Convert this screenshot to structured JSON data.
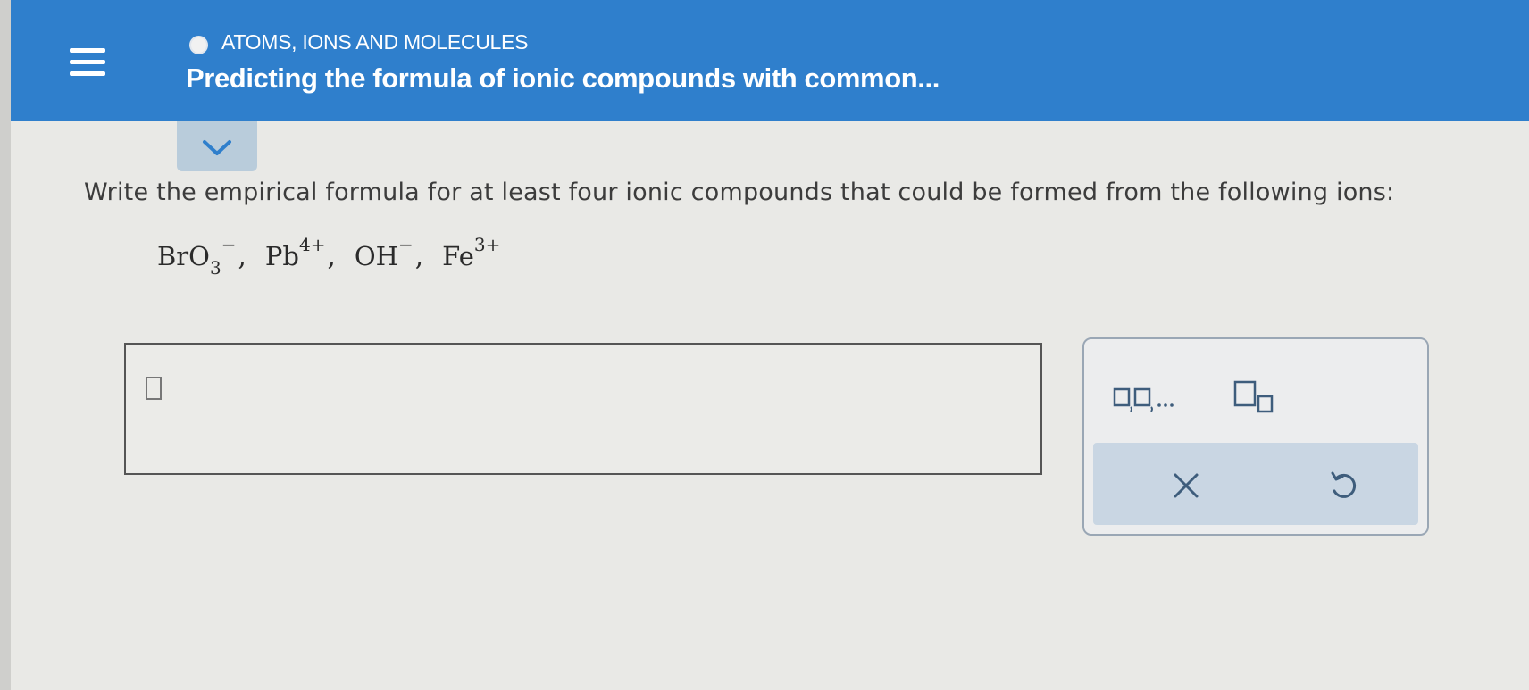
{
  "header": {
    "topic": "ATOMS, IONS AND MOLECULES",
    "title": "Predicting the formula of ionic compounds with common..."
  },
  "question": {
    "prompt": "Write the empirical formula for at least four ionic compounds that could be formed from the following ions:",
    "ions": [
      {
        "symbol": "BrO",
        "subscript": "3",
        "charge": "−",
        "separator": ","
      },
      {
        "symbol": "Pb",
        "subscript": "",
        "charge": "4+",
        "separator": ","
      },
      {
        "symbol": "OH",
        "subscript": "",
        "charge": "−",
        "separator": ","
      },
      {
        "symbol": "Fe",
        "subscript": "",
        "charge": "3+",
        "separator": ""
      }
    ]
  },
  "toolbar": {
    "sequence_label": "□,□,...",
    "icons": [
      "menu-icon",
      "chevron-down-icon",
      "sequence-icon",
      "subscript-icon",
      "clear-icon",
      "undo-icon"
    ]
  },
  "colors": {
    "header_bg": "#2f7fcc",
    "page_bg": "#e9e9e6",
    "toolbar_bar_bg": "#c9d6e3",
    "expand_btn_bg": "#b9ccdb"
  }
}
